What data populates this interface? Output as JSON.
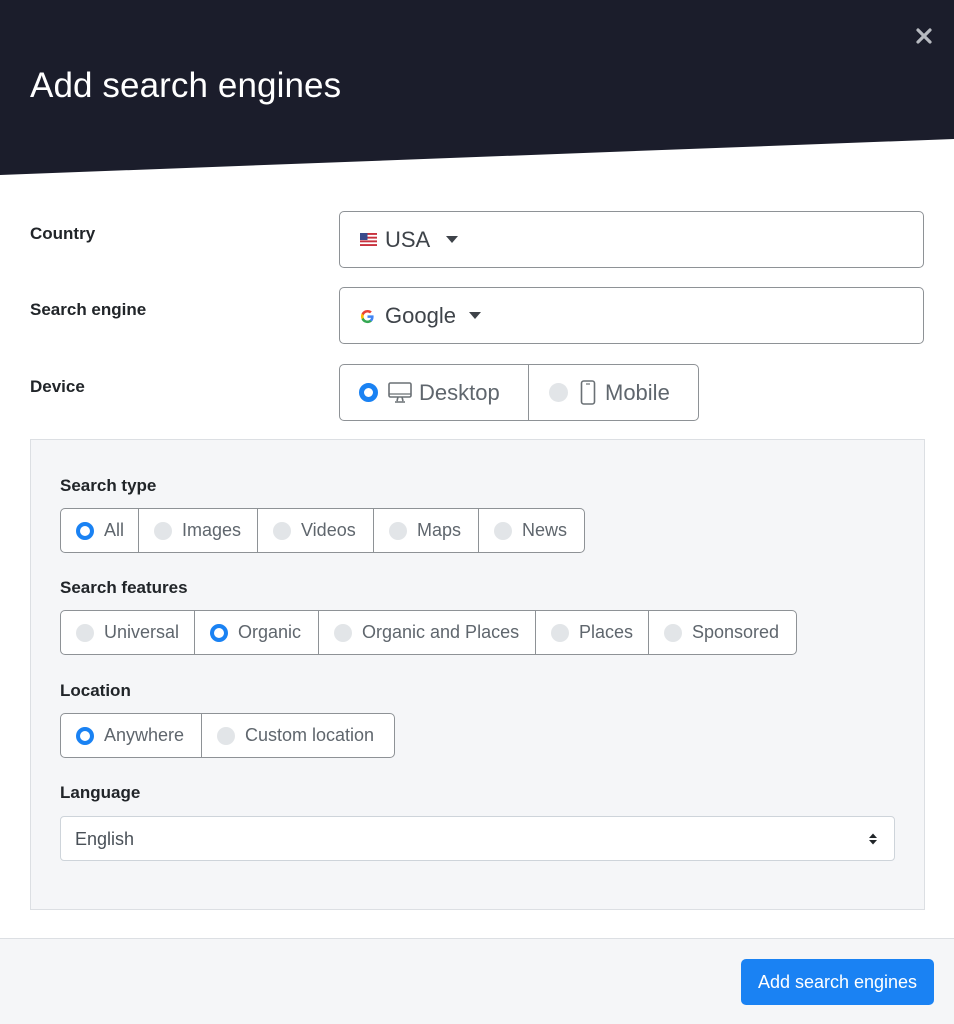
{
  "modal": {
    "title": "Add search engines",
    "close_icon": "close-icon"
  },
  "colors": {
    "header_bg": "#1b1d2b",
    "accent": "#1a82f3",
    "panel_bg": "#f5f6f8"
  },
  "form": {
    "country": {
      "label": "Country",
      "value": "USA",
      "icon": "us-flag-icon"
    },
    "engine": {
      "label": "Search engine",
      "value": "Google",
      "icon": "google-g-icon"
    },
    "device": {
      "label": "Device",
      "options": [
        {
          "label": "Desktop",
          "icon": "desktop-icon",
          "checked": true
        },
        {
          "label": "Mobile",
          "icon": "mobile-phone-icon",
          "checked": false
        }
      ]
    }
  },
  "panel": {
    "search_type": {
      "label": "Search type",
      "options": [
        {
          "label": "All",
          "checked": true
        },
        {
          "label": "Images",
          "checked": false
        },
        {
          "label": "Videos",
          "checked": false
        },
        {
          "label": "Maps",
          "checked": false
        },
        {
          "label": "News",
          "checked": false
        }
      ]
    },
    "search_features": {
      "label": "Search features",
      "options": [
        {
          "label": "Universal",
          "checked": false
        },
        {
          "label": "Organic",
          "checked": true
        },
        {
          "label": "Organic and Places",
          "checked": false
        },
        {
          "label": "Places",
          "checked": false
        },
        {
          "label": "Sponsored",
          "checked": false
        }
      ]
    },
    "location": {
      "label": "Location",
      "options": [
        {
          "label": "Anywhere",
          "checked": true
        },
        {
          "label": "Custom location",
          "checked": false
        }
      ]
    },
    "language": {
      "label": "Language",
      "value": "English"
    }
  },
  "footer": {
    "submit_label": "Add search engines"
  }
}
